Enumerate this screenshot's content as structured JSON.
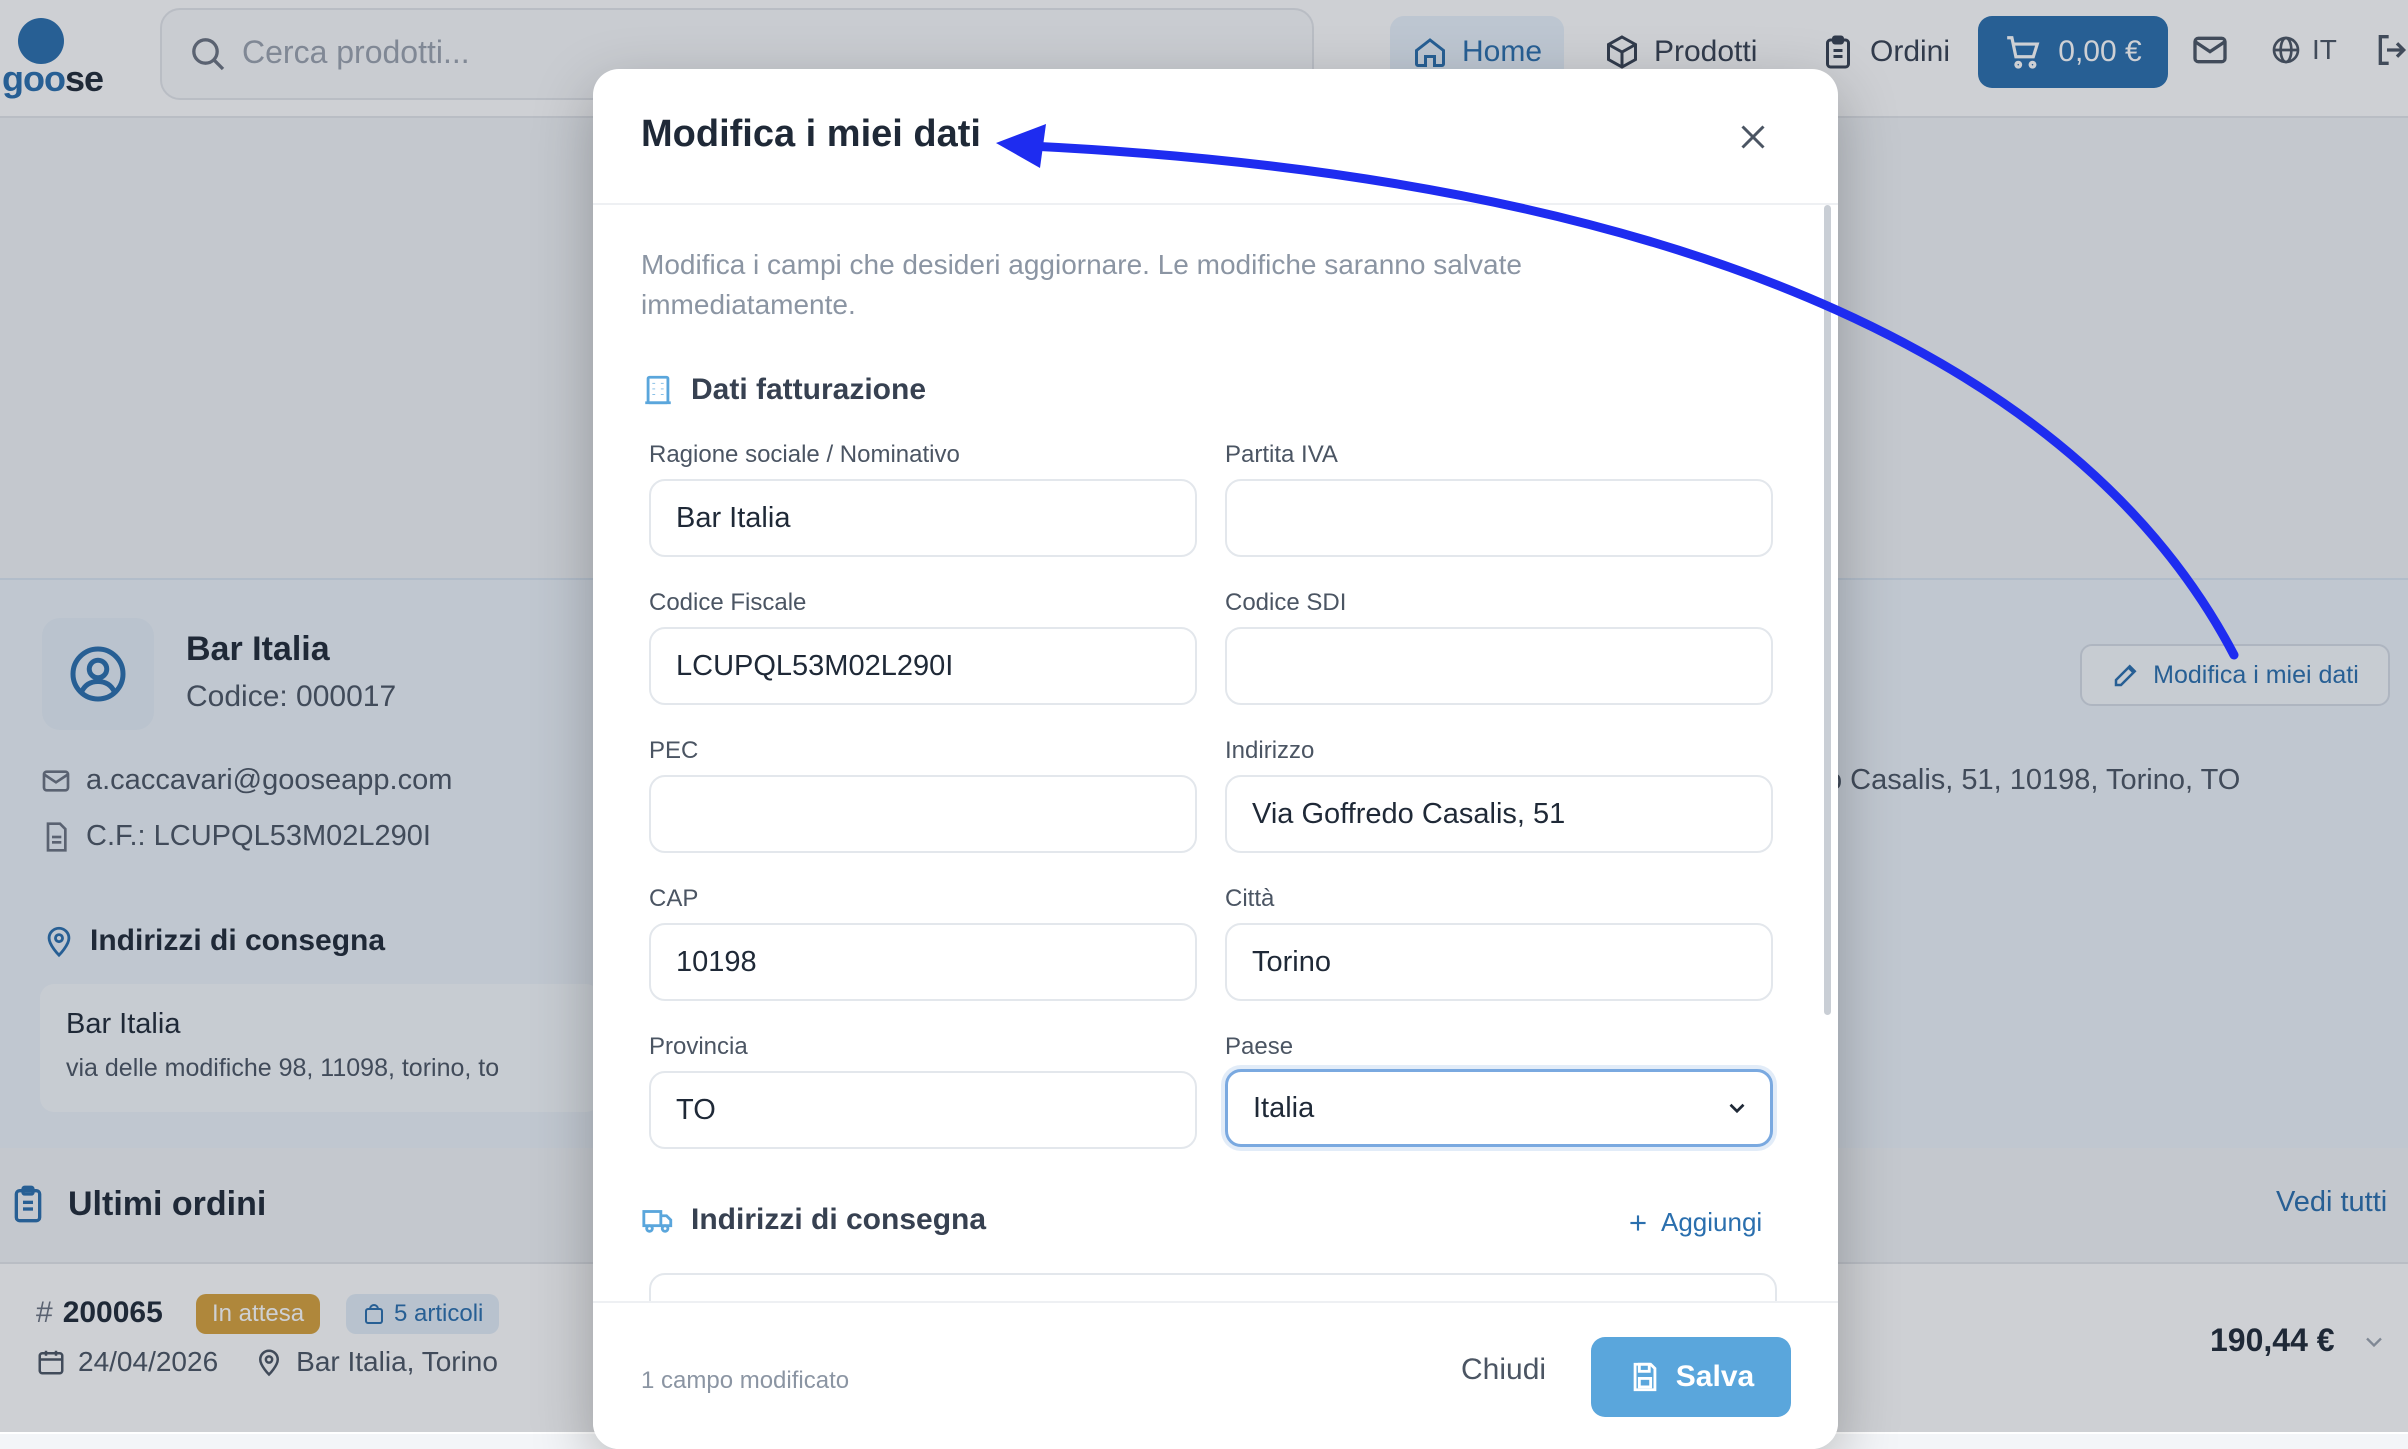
{
  "header": {
    "logo": {
      "go": "goo",
      "se": "se"
    },
    "search_placeholder": "Cerca prodotti...",
    "nav": {
      "home": "Home",
      "products": "Prodotti",
      "orders": "Ordini"
    },
    "cart_total": "0,00 €",
    "language": "IT",
    "icons": [
      "search-icon",
      "home-icon",
      "box-icon",
      "clipboard-icon",
      "cart-icon",
      "mail-icon",
      "globe-icon",
      "logout-icon"
    ]
  },
  "profile": {
    "name": "Bar Italia",
    "code": "Codice: 000017",
    "email": "a.caccavari@gooseapp.com",
    "tax_code": "C.F.: LCUPQL53M02L290I",
    "address_partial": "o Casalis, 51, 10198, Torino, TO",
    "edit_button": "Modifica i miei dati",
    "shipping_title": "Indirizzi di consegna",
    "shipping_card": {
      "name": "Bar Italia",
      "address": "via delle modifiche 98, 11098, torino, to"
    }
  },
  "orders": {
    "title": "Ultimi ordini",
    "see_all": "Vedi tutti",
    "latest": {
      "number": "200065",
      "status": "In attesa",
      "items": "5 articoli",
      "date": "24/04/2026",
      "location": "Bar Italia, Torino",
      "total": "190,44 €"
    }
  },
  "modal": {
    "title": "Modifica i miei dati",
    "description": "Modifica i campi che desideri aggiornare. Le modifiche saranno salvate immediatamente.",
    "billing_title": "Dati fatturazione",
    "fields": {
      "company_name": {
        "label": "Ragione sociale / Nominativo",
        "value": "Bar Italia"
      },
      "vat": {
        "label": "Partita IVA",
        "value": ""
      },
      "fiscal_code": {
        "label": "Codice Fiscale",
        "value": "LCUPQL53M02L290I"
      },
      "sdi": {
        "label": "Codice SDI",
        "value": ""
      },
      "pec": {
        "label": "PEC",
        "value": ""
      },
      "address": {
        "label": "Indirizzo",
        "value": "Via Goffredo Casalis, 51"
      },
      "cap": {
        "label": "CAP",
        "value": "10198"
      },
      "city": {
        "label": "Città",
        "value": "Torino"
      },
      "province": {
        "label": "Provincia",
        "value": "TO"
      },
      "country": {
        "label": "Paese",
        "value": "Italia"
      }
    },
    "shipping_title": "Indirizzi di consegna",
    "add_label": "Aggiungi",
    "changed_count": "1 campo modificato",
    "close_label": "Chiudi",
    "save_label": "Salva"
  },
  "colors": {
    "accent": "#2a6fae",
    "save": "#5aa6dc",
    "pending": "#d8a23b",
    "annotation_arrow": "#1e2cf0"
  }
}
